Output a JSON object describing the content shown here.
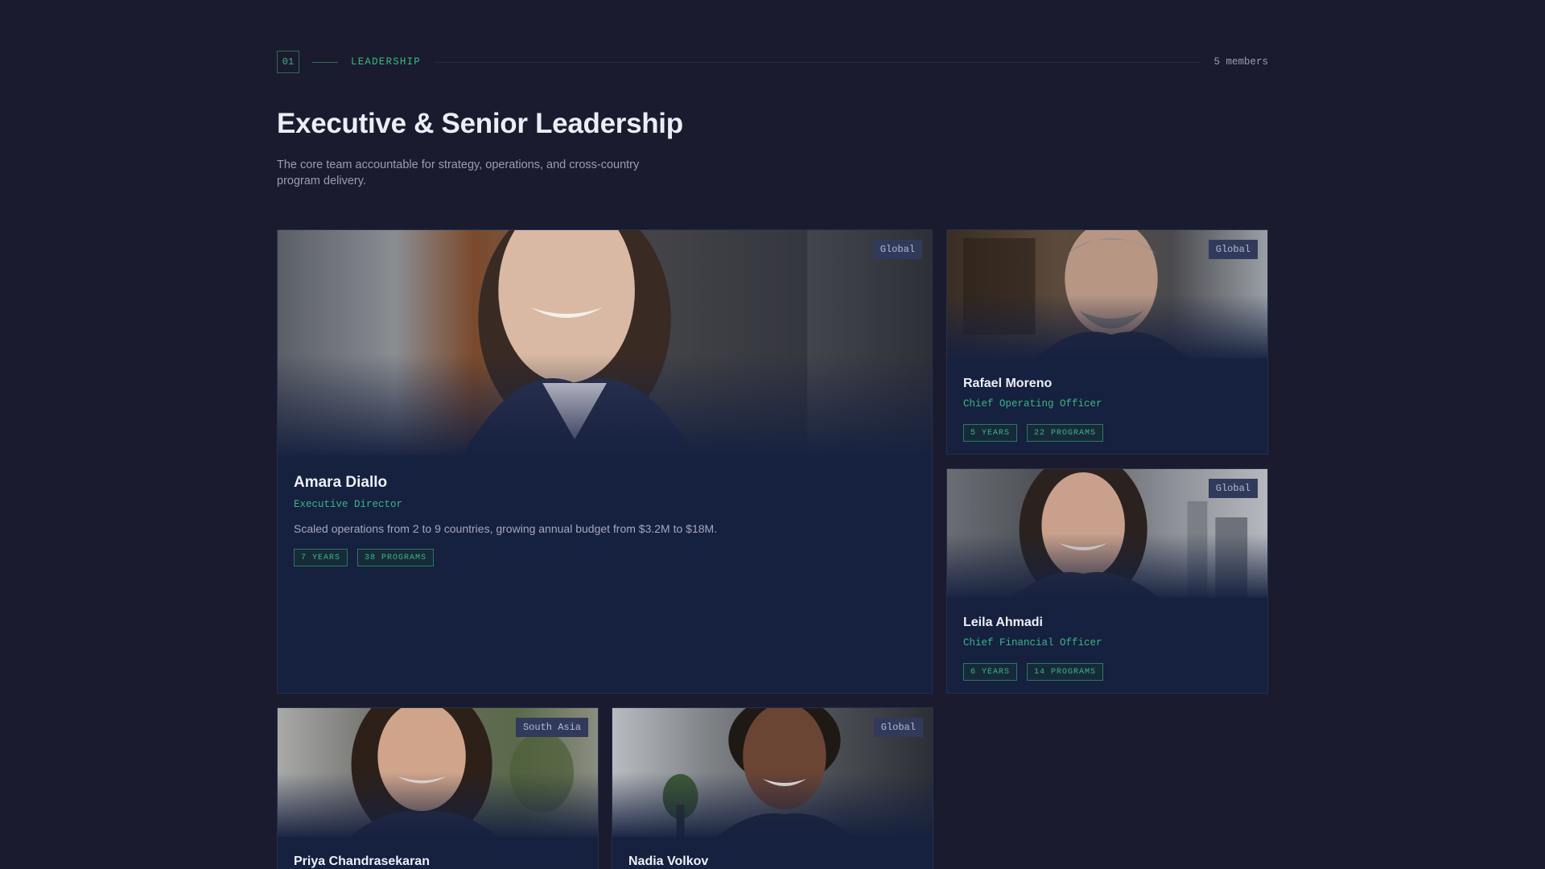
{
  "section": {
    "number": "01",
    "label": "LEADERSHIP",
    "member_count": "5 members"
  },
  "title": "Executive & Senior Leadership",
  "description": "The core team accountable for strategy, operations, and cross-country program delivery.",
  "colors": {
    "background": "#1a1b2e",
    "card": "#16203f",
    "accent": "#38b885",
    "badge": "#323a5c"
  },
  "members": [
    {
      "name": "Amara Diallo",
      "role": "Executive Director",
      "region": "Global",
      "bio": "Scaled operations from 2 to 9 countries, growing annual budget from $3.2M to $18M.",
      "tags": [
        "7 YEARS",
        "38 PROGRAMS"
      ]
    },
    {
      "name": "Rafael Moreno",
      "role": "Chief Operating Officer",
      "region": "Global",
      "tags": [
        "5 YEARS",
        "22 PROGRAMS"
      ]
    },
    {
      "name": "Leila Ahmadi",
      "role": "Chief Financial Officer",
      "region": "Global",
      "tags": [
        "6 YEARS",
        "14 PROGRAMS"
      ]
    },
    {
      "name": "Priya Chandrasekaran",
      "region": "South Asia"
    },
    {
      "name": "Nadia Volkov",
      "region": "Global"
    }
  ]
}
